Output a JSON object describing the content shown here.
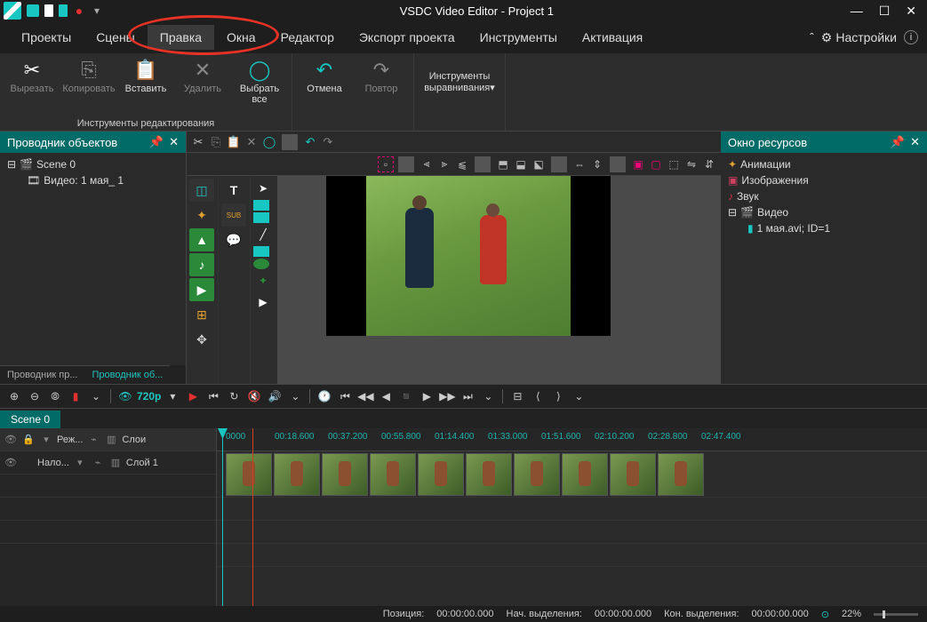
{
  "app": {
    "title": "VSDC Video Editor - Project 1"
  },
  "menu": {
    "items": [
      "Проекты",
      "Сцены",
      "Правка",
      "Окна",
      "Редактор",
      "Экспорт проекта",
      "Инструменты",
      "Активация"
    ],
    "active_index": 2,
    "settings_label": "Настройки"
  },
  "ribbon": {
    "group1_caption": "Инструменты редактирования",
    "cut": "Вырезать",
    "copy": "Копировать",
    "paste": "Вставить",
    "delete": "Удалить",
    "select_all": "Выбрать все",
    "undo": "Отмена",
    "redo": "Повтор",
    "align_tools": "Инструменты выравнивания▾"
  },
  "explorer": {
    "title": "Проводник объектов",
    "scene": "Scene 0",
    "video_item": "Видео: 1 мая_ 1",
    "tab1": "Проводник пр...",
    "tab2": "Проводник об..."
  },
  "resources": {
    "title": "Окно ресурсов",
    "animations": "Анимации",
    "images": "Изображения",
    "sound": "Звук",
    "video": "Видео",
    "file": "1 мая.avi; ID=1"
  },
  "transport": {
    "quality": "720p",
    "quality_dd": "▾"
  },
  "timeline": {
    "scene_tab": "Scene 0",
    "hdr_mode": "Реж...",
    "hdr_layers": "Слои",
    "row_name": "Нало...",
    "row_layer": "Слой 1",
    "ticks": [
      "0000",
      "00:18.600",
      "00:37.200",
      "00:55.800",
      "01:14.400",
      "01:33.000",
      "01:51.600",
      "02:10.200",
      "02:28.800",
      "02:47.400"
    ]
  },
  "status": {
    "position_label": "Позиция:",
    "position_value": "00:00:00.000",
    "sel_start_label": "Нач. выделения:",
    "sel_start_value": "00:00:00.000",
    "sel_end_label": "Кон. выделения:",
    "sel_end_value": "00:00:00.000",
    "zoom": "22%"
  }
}
